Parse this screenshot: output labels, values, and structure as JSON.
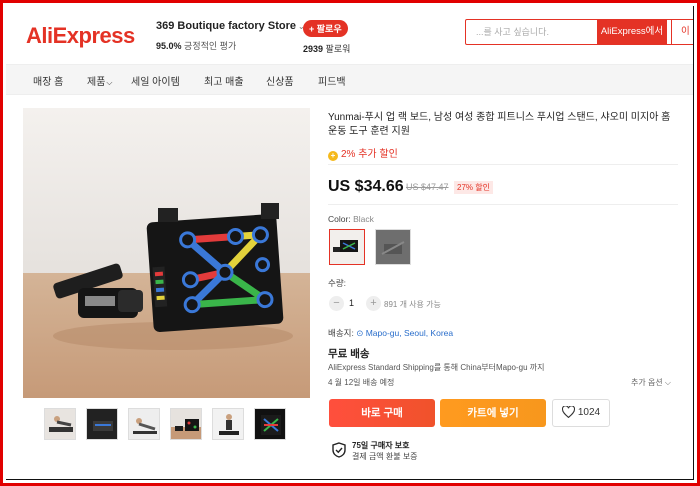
{
  "colors": {
    "brand": "#e43225",
    "buy": "#f0522b",
    "cart": "#f7971d",
    "link": "#2a6ecb"
  },
  "header": {
    "logo": "AliExpress",
    "store_name": "369 Boutique factory Store",
    "store_rating_value": "95.0%",
    "store_rating_label": "긍정적인 평가",
    "follow_label": "+ 팔로우",
    "follower_count": "2939",
    "follower_label": "팔로워",
    "search_placeholder": "...를 사고 싶습니다.",
    "search_button_1": "AliExpress에서",
    "search_button_2": "이 가"
  },
  "nav": {
    "items": [
      "매장 홈",
      "제품",
      "세일 아이템",
      "최고 매출",
      "신상품",
      "피드백"
    ]
  },
  "product": {
    "title": "Yunmai-푸시 업 랙 보드, 남성 여성 종합 피트니스 푸시업 스탠드, 샤오미 미지아 홈 운동 도구 훈련 지원",
    "extra_discount": "2% 추가 할인",
    "price": "US $34.66",
    "old_price": "US $47.47",
    "discount": "27% 할인",
    "color_label": "Color:",
    "color_value": "Black",
    "quantity_label": "수량:",
    "quantity": "1",
    "quantity_available": "891 개 사용 가능",
    "ship_to_label": "배송지:",
    "ship_to_value": "Mapo-gu, Seoul, Korea",
    "shipping_free": "무료 배송",
    "shipping_method": "AliExpress Standard Shipping를 통해 China부터Mapo-gu 까지",
    "delivery_date": "4 월 12일 배송 예정",
    "more_options": "추가 옵션",
    "buy_now": "바로 구매",
    "add_to_cart": "카트에 넣기",
    "wishlist_count": "1024",
    "protection_title": "75일 구매자 보호",
    "protection_sub": "결제 금액 환불 보증"
  }
}
